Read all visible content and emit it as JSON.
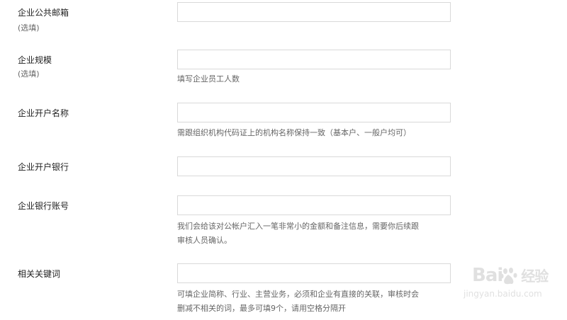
{
  "form": {
    "email": {
      "label": "企业公共邮箱",
      "optional": "(选填)",
      "value": ""
    },
    "size": {
      "label": "企业规模",
      "optional": "(选填)",
      "value": "",
      "hint": "填写企业员工人数"
    },
    "account_name": {
      "label": "企业开户名称",
      "value": "",
      "hint": "需跟组织机构代码证上的机构名称保持一致（基本户、一般户均可）"
    },
    "bank": {
      "label": "企业开户银行",
      "value": ""
    },
    "bank_account": {
      "label": "企业银行账号",
      "value": "",
      "hint_line1": "我们会给该对公帐户汇入一笔非常小的金额和备注信息，需要你后续跟",
      "hint_line2": "审核人员确认。"
    },
    "keywords": {
      "label": "相关关键词",
      "value": "",
      "hint_line1": "可填企业简称、行业、主营业务，必须和企业有直接的关联，审核时会",
      "hint_line2": "删减不相关的词，最多可填9个，请用空格分隔开"
    }
  },
  "watermark": {
    "brand": "Bai",
    "brand_tail": "经验",
    "url": "jingyan.baidu.com",
    "color": "#c8c8c8"
  }
}
